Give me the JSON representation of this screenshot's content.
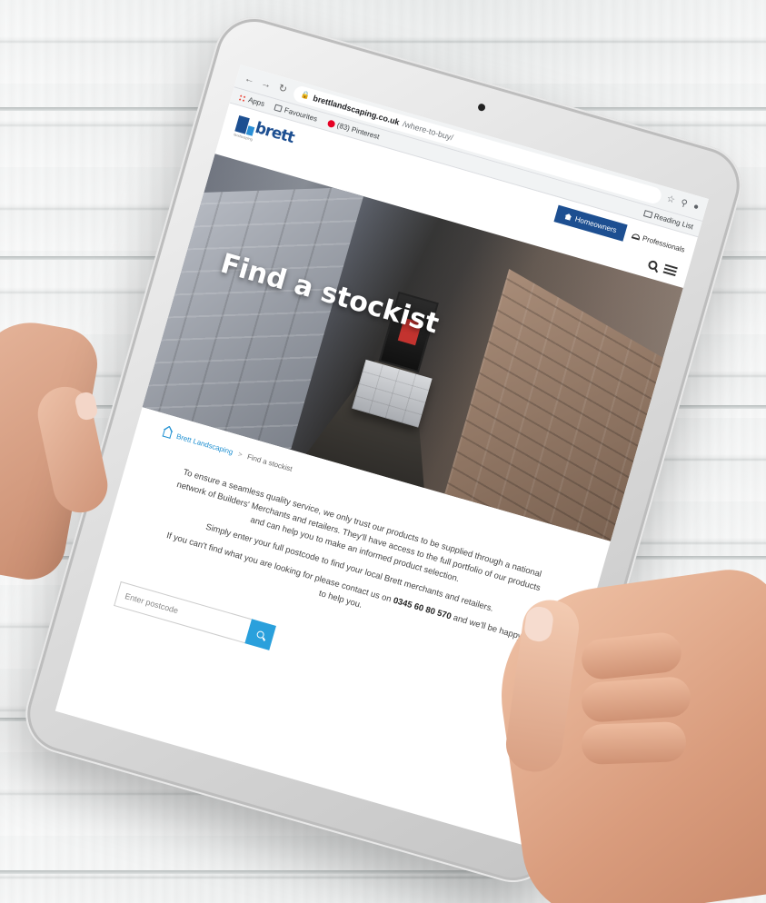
{
  "browser": {
    "url_host": "brettlandscaping.co.uk",
    "url_path": "/where-to-buy/",
    "bookmarks": [
      "Apps",
      "Favourites",
      "(83) Pinterest"
    ],
    "reading_list": "Reading List"
  },
  "site": {
    "logo_text": "brett",
    "logo_tagline": "landscaping",
    "homeowners_label": "Homeowners",
    "professionals_label": "Professionals"
  },
  "hero": {
    "title": "Find a stockist"
  },
  "breadcrumb": {
    "home": "Brett Landscaping",
    "separator": ">",
    "current": "Find a stockist"
  },
  "content": {
    "intro_1": "To ensure a seamless quality service, we only trust our products to be supplied through a national network of Builders' Merchants and retailers. They'll have access to the full portfolio of our products and can help you to make an informed product selection.",
    "intro_2": "Simply enter your full postcode to find your local Brett merchants and retailers.",
    "contact_prefix": "If you can't find what you are looking for please contact us on",
    "phone": "0345 60 80 570",
    "contact_suffix": "and we'll be happy to help you."
  },
  "search": {
    "placeholder": "Enter postcode"
  },
  "colors": {
    "brand_blue": "#1d4f91",
    "accent_blue": "#2aa0dc"
  }
}
